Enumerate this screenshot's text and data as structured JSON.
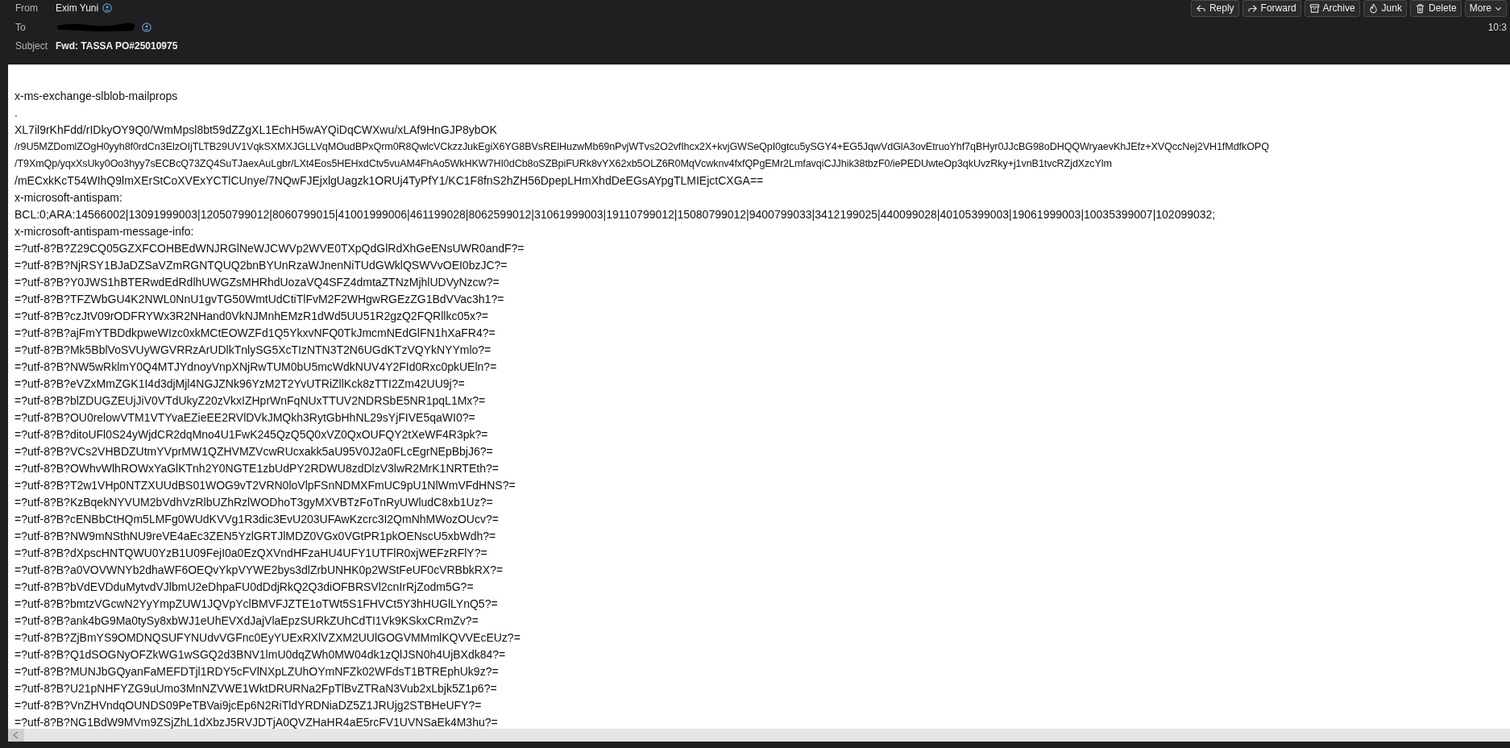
{
  "header": {
    "from": {
      "label": "From",
      "name": "Exim Yuni"
    },
    "to": {
      "label": "To",
      "redacted": true
    },
    "subject": {
      "label": "Subject",
      "value": "Fwd: TASSA PO#25010975"
    },
    "time": "10:3",
    "actions": [
      {
        "label": "Reply",
        "kind": "reply"
      },
      {
        "label": "Forward",
        "kind": "forward"
      },
      {
        "label": "Archive",
        "kind": "archive"
      },
      {
        "label": "Junk",
        "kind": "junk"
      },
      {
        "label": "Delete",
        "kind": "delete"
      },
      {
        "label": "More",
        "kind": "more"
      }
    ]
  },
  "body": {
    "lines": [
      "x-ms-exchange-slblob-mailprops",
      ".",
      "XL7il9rKhFdd/rIDkyOY9Q0/WmMpsl8bt59dZZgXL1EchH5wAYQiDqCWXwu/xLAf9HnGJP8ybOK",
      "/r9U5MZDomlZOgH0yyh8f0rdCn3ElzOIjTLTB29UV1VqkSXMXJGLLVqMOudBPxQrm0R8QwlcVCkzzJukEgiX6YG8BVsRElHuzwMb69nPvjWTvs2O2vfIhcx2X+kvjGWSeQpI0gtcu5ySGY4+EG5JqwVdGlA3ovEtruoYhf7qBHyr0JJcBG98oDHQQWryaevKhJEfz+XVQccNej2VH1fMdfkOPQ",
      "/T9XmQp/yqxXsUky0Oo3hyy7sECBcQ73ZQ4SuTJaexAuLgbr/LXt4Eos5HEHxdCtv5vuAM4FhAo5WkHKW7HI0dCb8oSZBpiFURk8vYX62xb5OLZ6R0MqVcwknv4fxfQPgEMr2LmfavqiCJJhik38tbzF0/iePEDUwteOp3qkUvzRky+j1vnB1tvcRZjdXzcYlm",
      "/mECxkKcT54WIhQ9lmXErStCoXVExYCTlCUnye/7NQwFJEjxlgUagzk1ORUj4TyPfY1/KC1F8fnS2hZH56DpepLHmXhdDeEGsAYpgTLMIEjctCXGA==",
      "x-microsoft-antispam:",
      "BCL:0;ARA:14566002|13091999003|12050799012|8060799015|41001999006|461199028|8062599012|31061999003|19110799012|15080799012|9400799033|3412199025|440099028|40105399003|19061999003|10035399007|102099032;",
      "x-microsoft-antispam-message-info:",
      "=?utf-8?B?Z29CQ05GZXFCOHBEdWNJRGlNeWJCWVp2WVE0TXpQdGlRdXhGeENsUWR0andF?=",
      "=?utf-8?B?NjRSY1BJaDZSaVZmRGNTQUQ2bnBYUnRzaWJnenNiTUdGWklQSWVvOEI0bzJC?=",
      "=?utf-8?B?Y0JWS1hBTERwdEdRdlhUWGZsMHRhdUozaVQ4SFZ4dmtaZTNzMjhlUDVyNzcw?=",
      "=?utf-8?B?TFZWbGU4K2NWL0NnU1gvTG50WmtUdCtiTlFvM2F2WHgwRGEzZG1BdVVac3h1?=",
      "=?utf-8?B?czJtV09rODFRYWx3R2NHand0VkNJMnhEMzR1dWd5UU51R2gzQ2FQRllkc05x?=",
      "=?utf-8?B?ajFmYTBDdkpweWIzc0xkMCtEOWZFd1Q5YkxvNFQ0TkJmcmNEdGlFN1hXaFR4?=",
      "=?utf-8?B?Mk5BblVoSVUyWGVRRzArUDlkTnlySG5XcTIzNTN3T2N6UGdKTzVQYkNYYmlo?=",
      "=?utf-8?B?NW5wRklmY0Q4MTJYdnoyVnpXNjRwTUM0bU5mcWdkNUV4Y2FId0Rxc0pkUEln?=",
      "=?utf-8?B?eVZxMmZGK1I4d3djMjl4NGJZNk96YzM2T2YvUTRiZllKck8zTTI2Zm42UU9j?=",
      "=?utf-8?B?blZDUGZEUjJiV0VTdUkyZ20zVkxIZHprWnFqNUxTTUV2NDRSbE5NR1pqL1Mx?=",
      "=?utf-8?B?OU0relowVTM1VTYvaEZieEE2RVlDVkJMQkh3RytGbHhNL29sYjFIVE5qaWI0?=",
      "=?utf-8?B?ditoUFl0S24yWjdCR2dqMno4U1FwK245QzQ5Q0xVZ0QxOUFQY2tXeWF4R3pk?=",
      "=?utf-8?B?VCs2VHBDZUtmYVprMW1QZHVMZVcwRUcxakk5aU95V0J2a0FLcEgrNEpBbjJ6?=",
      "=?utf-8?B?OWhvWlhROWxYaGlKTnh2Y0NGTE1zbUdPY2RDWU8zdDlzV3lwR2MrK1NRTEth?=",
      "=?utf-8?B?T2w1VHp0NTZXUUdBS01WOG9vT2VRN0loVlpFSnNDMXFmUC9pU1NlWmVFdHNS?=",
      "=?utf-8?B?KzBqekNYVUM2bVdhVzRlbUZhRzlWODhoT3gyMXVBTzFoTnRyUWludC8xb1Uz?=",
      "=?utf-8?B?cENBbCtHQm5LMFg0WUdKVVg1R3dic3EvU203UFAwKzcrc3I2QmNhMWozOUcv?=",
      "=?utf-8?B?NW9mNSthNU9reVE4aEc3ZEN5YzlGRTJlMDZ0VGx0VGtPR1pkOENscU5xbWdh?=",
      "=?utf-8?B?dXpscHNTQWU0YzB1U09FejI0a0EzQXVndHFzaHU4UFY1UTFlR0xjWEFzRFlY?=",
      "=?utf-8?B?a0VOVWNYb2dhaWF6OEQvYkpVYWE2bys3dlZrbUNHK0p2WStFeUF0cVRBbkRX?=",
      "=?utf-8?B?bVdEVDduMytvdVJlbmU2eDhpaFU0dDdjRkQ2Q3diOFBRSVl2cnIrRjZodm5G?=",
      "=?utf-8?B?bmtzVGcwN2YyYmpZUW1JQVpYclBMVFJZTE1oTWt5S1FHVCt5Y3hHUGlLYnQ5?=",
      "=?utf-8?B?ank4bG9Ma0tySy8xbWJ1eUhEVXdJajVlaEpzSURkZUhCdTI1Vk9KSkxCRmZv?=",
      "=?utf-8?B?ZjBmYS9OMDNQSUFYNUdvVGFnc0EyYUExRXlVZXM2UUlGOGVMMmlKQVVEcEUz?=",
      "=?utf-8?B?Q1dSOGNyOFZkWG1wSGQ2d3BNV1lmU0dqZWh0MW04dk1zQlJSN0h4UjBXdk84?=",
      "=?utf-8?B?MUNJbGQyanFaMEFDTjl1RDY5cFVlNXpLZUhOYmNFZk02WFdsT1BTREphUk9z?=",
      "=?utf-8?B?U21pNHFYZG9uUmo3MnNZVWE1WktDRURNa2FpTlBvZTRaN3Vub2xLbjk5Z1p6?=",
      "=?utf-8?B?VnZHVndqOUNDS09PeTBVai9jcEp6N2RiTldYRDNiaDZ5Z1JRUjg2STBHeUFY?=",
      "=?utf-8?B?NG1BdW9MVm9ZSjZhL1dXbzJ5RVJDTjA0QVZHaHR4aE5rcFV1UVNSaEk4M3hu?="
    ]
  }
}
